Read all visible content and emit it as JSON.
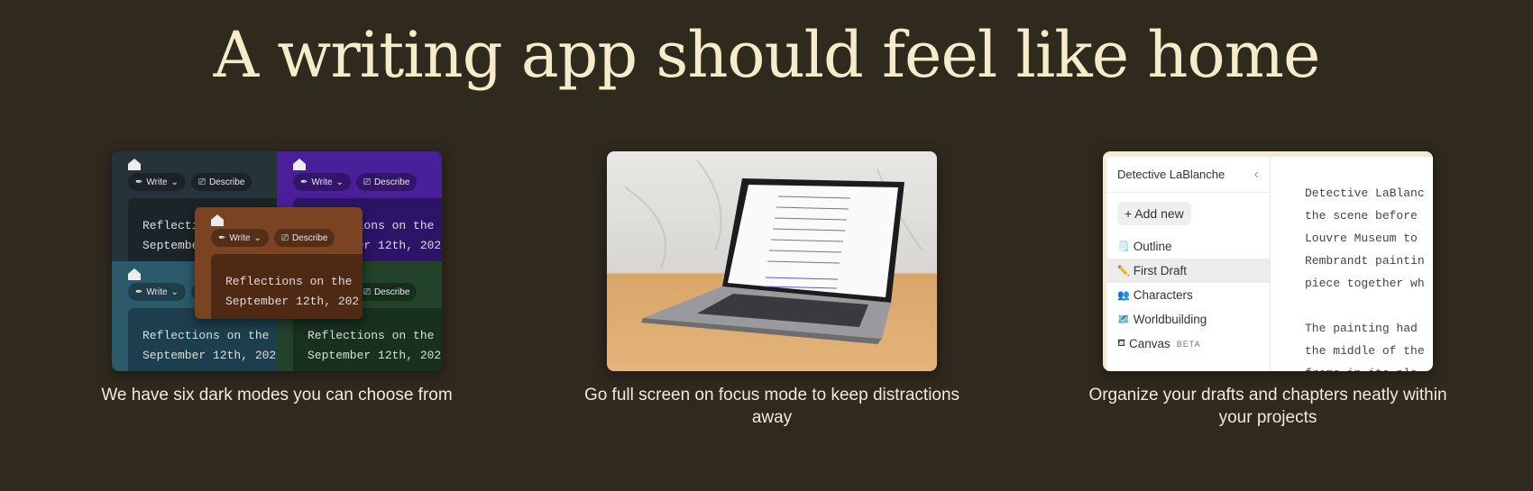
{
  "headline": "A writing app should feel like home",
  "features": [
    {
      "caption": "We have six dark modes you can choose from",
      "preview": {
        "write_label": "Write",
        "describe_label": "Describe",
        "text_line1": "Reflections on the",
        "text_line2": "September 12th, 202",
        "themes": [
          {
            "name": "slate",
            "bg": "#27333a",
            "box": "#1b2429"
          },
          {
            "name": "purple",
            "bg": "#4a1f9a",
            "box": "#2e1466"
          },
          {
            "name": "teal",
            "bg": "#2b5a6b",
            "box": "#1d3f4d"
          },
          {
            "name": "green",
            "bg": "#22422a",
            "box": "#18301e"
          },
          {
            "name": "brown",
            "bg": "#7a4322",
            "box": "#4e2a14"
          }
        ]
      }
    },
    {
      "caption": "Go full screen on focus mode to keep distractions away"
    },
    {
      "caption": "Organize your drafts and chapters neatly within your projects",
      "preview": {
        "project_title": "Detective LaBlanche",
        "add_new": "+ Add new",
        "items": [
          {
            "icon": "🗒️",
            "label": "Outline"
          },
          {
            "icon": "✏️",
            "label": "First Draft",
            "active": true
          },
          {
            "icon": "👥",
            "label": "Characters"
          },
          {
            "icon": "🗺️",
            "label": "Worldbuilding"
          },
          {
            "icon": "⛾",
            "label": "Canvas",
            "badge": "BETA"
          }
        ],
        "doc_lines": [
          "Detective LaBlanc",
          "the scene before",
          "Louvre Museum to",
          "Rembrandt paintin",
          "piece together wh",
          "",
          "The painting had",
          "the middle of the",
          "frame in its pla"
        ]
      }
    }
  ]
}
